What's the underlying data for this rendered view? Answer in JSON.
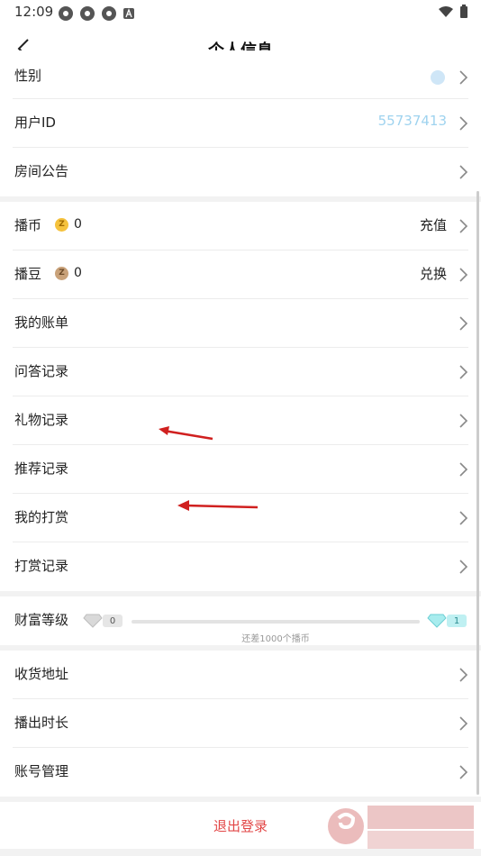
{
  "status_bar": {
    "time": "12:09"
  },
  "header": {
    "title": "个人信息"
  },
  "profile": {
    "gender_label": "性别",
    "user_id_label": "用户ID",
    "user_id_value": "55737413",
    "announcement_label": "房间公告"
  },
  "wallet": {
    "bobi_label": "播币",
    "bobi_value": "0",
    "bobi_action": "充值",
    "bodou_label": "播豆",
    "bodou_value": "0",
    "bodou_action": "兑换",
    "coin_letter": "Z"
  },
  "records": [
    {
      "label": "我的账单"
    },
    {
      "label": "问答记录"
    },
    {
      "label": "礼物记录"
    },
    {
      "label": "推荐记录"
    },
    {
      "label": "我的打赏"
    },
    {
      "label": "打赏记录"
    }
  ],
  "wealth": {
    "label": "财富等级",
    "current_level": "0",
    "next_level": "1",
    "hint": "还差1000个播币",
    "progress": 0
  },
  "settings": [
    {
      "label": "收货地址"
    },
    {
      "label": "播出时长"
    },
    {
      "label": "账号管理"
    }
  ],
  "logout": {
    "label": "退出登录"
  },
  "colors": {
    "accent_red": "#e24646",
    "uid_blue": "#9fd3ef",
    "bobi_coin": "#f5c23d",
    "bodou_coin": "#c9a27a"
  }
}
